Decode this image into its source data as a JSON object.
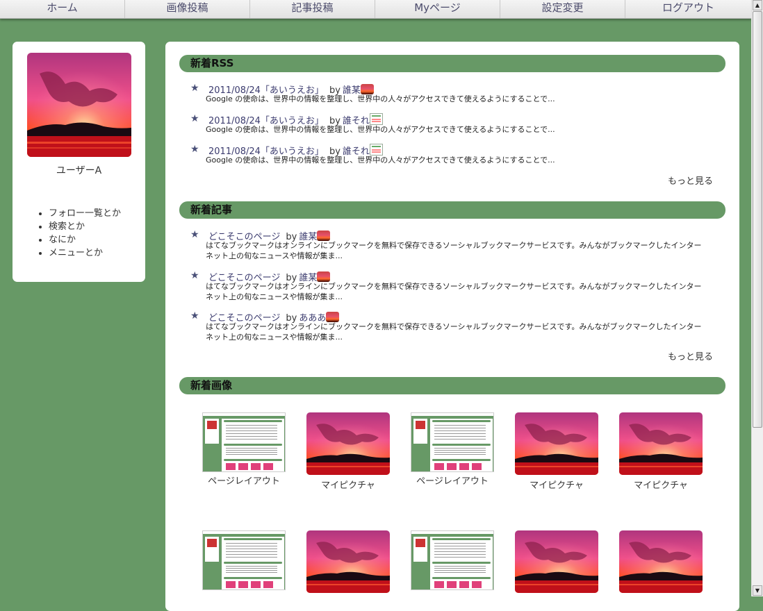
{
  "nav": {
    "items": [
      {
        "label": "ホーム"
      },
      {
        "label": "画像投稿"
      },
      {
        "label": "記事投稿"
      },
      {
        "label": "Myページ"
      },
      {
        "label": "設定変更"
      },
      {
        "label": "ログアウト"
      }
    ]
  },
  "sidebar": {
    "user_name": "ユーザーA",
    "menu": [
      "フォロー一覧とか",
      "検索とか",
      "なにか",
      "メニューとか"
    ]
  },
  "rss": {
    "heading": "新着RSS",
    "entries": [
      {
        "title": "2011/08/24「あいうえお」",
        "by": "by",
        "author": "誰某",
        "icon": "sunset-thumbnail-icon",
        "desc": "Google の使命は、世界中の情報を整理し、世界中の人々がアクセスできて使えるようにすることで..."
      },
      {
        "title": "2011/08/24「あいうえお」",
        "by": "by",
        "author": "誰それ",
        "icon": "page-layout-thumbnail-icon",
        "desc": "Google の使命は、世界中の情報を整理し、世界中の人々がアクセスできて使えるようにすることで..."
      },
      {
        "title": "2011/08/24「あいうえお」",
        "by": "by",
        "author": "誰それ",
        "icon": "page-layout-thumbnail-icon",
        "desc": "Google の使命は、世界中の情報を整理し、世界中の人々がアクセスできて使えるようにすることで..."
      }
    ],
    "more": "もっと見る"
  },
  "articles": {
    "heading": "新着記事",
    "entries": [
      {
        "title": "どこそこのページ",
        "by": "by",
        "author": "誰某",
        "icon": "sunset-thumbnail-icon",
        "desc": "はてなブックマークはオンラインにブックマークを無料で保存できるソーシャルブックマークサービスです。みんながブックマークしたインターネット上の旬なニュースや情報が集ま..."
      },
      {
        "title": "どこそこのページ",
        "by": "by",
        "author": "誰某",
        "icon": "sunset-thumbnail-icon",
        "desc": "はてなブックマークはオンラインにブックマークを無料で保存できるソーシャルブックマークサービスです。みんながブックマークしたインターネット上の旬なニュースや情報が集ま..."
      },
      {
        "title": "どこそこのページ",
        "by": "by",
        "author": "あああ",
        "icon": "sunset-thumbnail-icon",
        "desc": "はてなブックマークはオンラインにブックマークを無料で保存できるソーシャルブックマークサービスです。みんながブックマークしたインターネット上の旬なニュースや情報が集ま..."
      }
    ],
    "more": "もっと見る"
  },
  "images": {
    "heading": "新着画像",
    "items": [
      {
        "caption": "ページレイアウト",
        "kind": "layout"
      },
      {
        "caption": "マイピクチャ",
        "kind": "sunset"
      },
      {
        "caption": "ページレイアウト",
        "kind": "layout"
      },
      {
        "caption": "マイピクチャ",
        "kind": "sunset"
      },
      {
        "caption": "マイピクチャ",
        "kind": "sunset"
      },
      {
        "caption": "",
        "kind": "layout"
      },
      {
        "caption": "",
        "kind": "sunset"
      },
      {
        "caption": "",
        "kind": "layout"
      },
      {
        "caption": "",
        "kind": "sunset"
      },
      {
        "caption": "",
        "kind": "sunset"
      }
    ]
  },
  "colors": {
    "page_bg": "#679966",
    "section_header": "#679966",
    "link": "#3b3b6e"
  }
}
